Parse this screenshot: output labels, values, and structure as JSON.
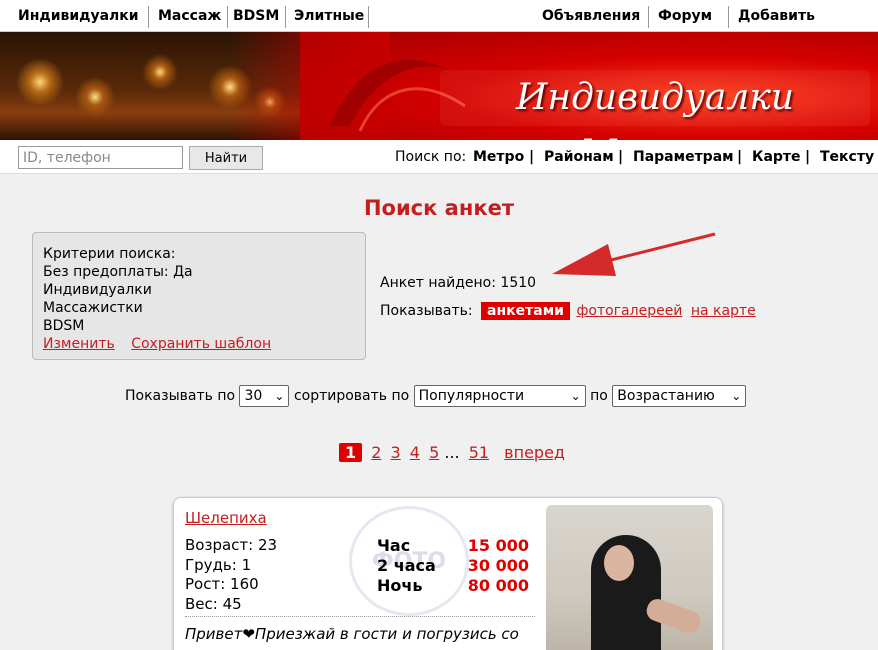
{
  "topnav": {
    "left": [
      {
        "label": "Индивидуалки"
      },
      {
        "label": "Массаж"
      },
      {
        "label": "BDSM"
      },
      {
        "label": "Элитные"
      }
    ],
    "right": [
      {
        "label": "Объявления"
      },
      {
        "label": "Форум"
      },
      {
        "label": "Добавить анкету"
      }
    ]
  },
  "banner": {
    "title": "Индивидуалки Москвы"
  },
  "search": {
    "placeholder": "ID, телефон",
    "button": "Найти",
    "by_label": "Поиск по:",
    "options": [
      "Метро",
      "Районам",
      "Параметрам",
      "Карте",
      "Тексту"
    ]
  },
  "main": {
    "title": "Поиск анкет",
    "criteria": {
      "heading": "Критерии поиска:",
      "lines": [
        "Без предоплаты: Да",
        "Индивидуалки",
        "Массажистки",
        "BDSM"
      ],
      "edit_link": "Изменить",
      "save_link": "Сохранить шаблон"
    },
    "found_text": "Анкет найдено: 1510",
    "show": {
      "label": "Показывать:",
      "active": "анкетами",
      "gallery": "фотогалереей",
      "map": "на карте"
    },
    "controls": {
      "per_label": "Показывать по",
      "per_value": "30",
      "sort_label": "сортировать по",
      "sort_value": "Популярности",
      "order_label": "по",
      "order_value": "Возрастанию"
    },
    "pager": {
      "current": "1",
      "pages": [
        "2",
        "3",
        "4",
        "5"
      ],
      "ellipsis": "...",
      "last": "51",
      "next": "вперед"
    }
  },
  "card": {
    "location": "Шелепиха",
    "stats": [
      "Возраст: 23",
      "Грудь: 1",
      "Рост: 160",
      "Вес: 45"
    ],
    "prices": [
      {
        "label": "Час",
        "value": "15 000"
      },
      {
        "label": "2 часа",
        "value": "30 000"
      },
      {
        "label": "Ночь",
        "value": "80 000"
      }
    ],
    "watermark": "ФОТО",
    "description": "Привет❤Приезжай в гости и погрузись со"
  },
  "colors": {
    "accent": "#e00000",
    "link": "#c41e1e"
  }
}
